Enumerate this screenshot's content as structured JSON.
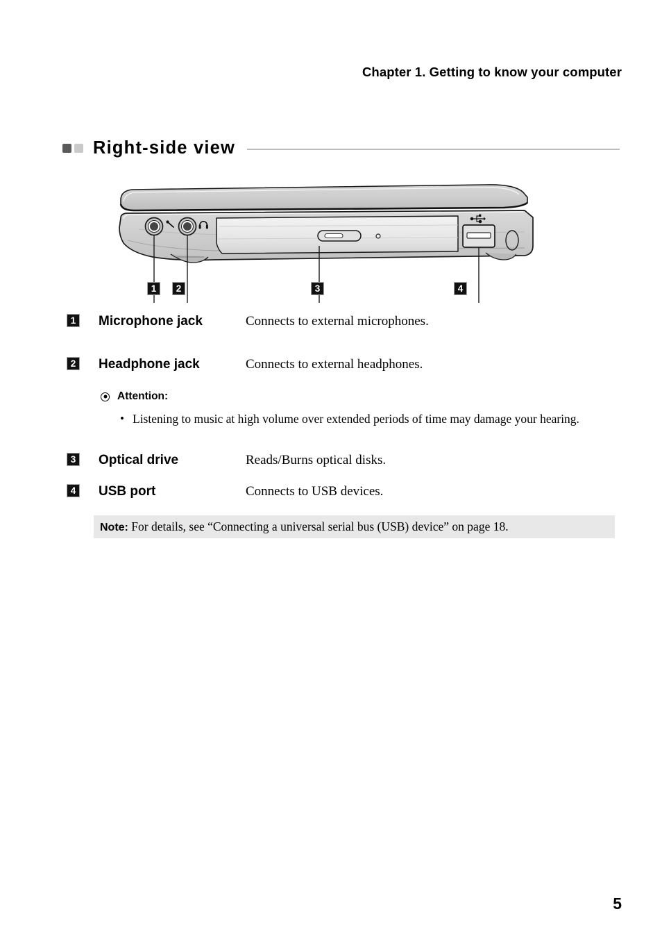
{
  "header": {
    "chapter_title": "Chapter 1. Getting to know your computer"
  },
  "section": {
    "title": "Right-side view",
    "marker_dark_color": "#595959",
    "marker_light_color": "#c9c9c9",
    "rule_color": "#bcbcbc"
  },
  "figure": {
    "alt": "Right-side view of laptop showing microphone jack, headphone jack, optical drive and USB port",
    "callouts": [
      {
        "number": "1",
        "target": "microphone-jack"
      },
      {
        "number": "2",
        "target": "headphone-jack"
      },
      {
        "number": "3",
        "target": "optical-drive"
      },
      {
        "number": "4",
        "target": "usb-port"
      }
    ],
    "port_icons": [
      "microphone-icon",
      "headphone-icon",
      "usb-trident-icon"
    ]
  },
  "features": [
    {
      "number": "1",
      "name": "Microphone jack",
      "description": "Connects to external microphones."
    },
    {
      "number": "2",
      "name": "Headphone jack",
      "description": "Connects to external headphones."
    },
    {
      "number": "3",
      "name": "Optical drive",
      "description": "Reads/Burns optical disks."
    },
    {
      "number": "4",
      "name": "USB port",
      "description": "Connects to USB devices."
    }
  ],
  "attention": {
    "icon": "attention-icon",
    "label": "Attention:",
    "bullet_glyph": "•",
    "items": [
      "Listening to music at high volume over extended periods of time may damage your hearing."
    ]
  },
  "note": {
    "label": "Note:",
    "text": " For details, see “Connecting a universal serial bus (USB) device” on page 18.",
    "background_color": "#e8e8e8"
  },
  "footer": {
    "page_number": "5"
  }
}
